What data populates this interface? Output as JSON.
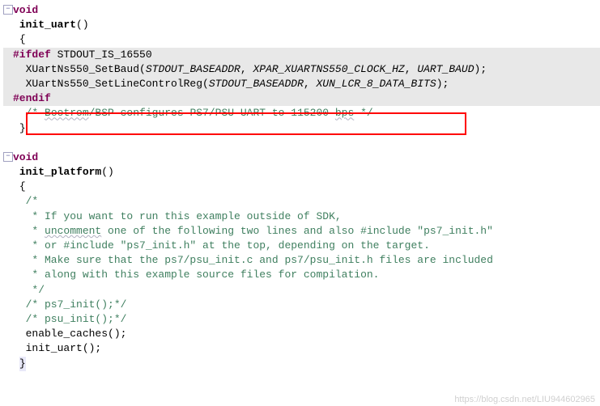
{
  "fn1": {
    "void": "void",
    "name": "init_uart",
    "sig": "()",
    "open": "{",
    "close": "}",
    "ifdef": "#ifdef",
    "ifdef_cond": " STDOUT_IS_16550",
    "l1a": "  XUartNs550_SetBaud",
    "l1b": "(",
    "l1c": "STDOUT_BASEADDR",
    "l1d": ", ",
    "l1e": "XPAR_XUARTNS550_CLOCK_HZ",
    "l1f": ", ",
    "l1g": "UART_BAUD",
    "l1h": ");",
    "l2a": "  XUartNs550_SetLineControlReg",
    "l2b": "(",
    "l2c": "STDOUT_BASEADDR",
    "l2d": ", ",
    "l2e": "XUN_LCR_8_DATA_BITS",
    "l2f": ");",
    "endif": "#endif",
    "comment_pre": "  /* ",
    "comment_w1": "Bootrom",
    "comment_mid1": "/BSP configures PS7/PSU UART to 115200 ",
    "comment_w2": "bps",
    "comment_post": " */"
  },
  "fn2": {
    "void": "void",
    "name": "init_platform",
    "sig": "()",
    "open": "{",
    "close": "}",
    "c_open": "  /*",
    "c1": "   * If you want to run this example outside of SDK,",
    "c2a": "   * ",
    "c2w": "uncomment",
    "c2b": " one of the following two lines and also #include \"ps7_init.h\"",
    "c3": "   * or #include \"ps7_init.h\" at the top, depending on the target.",
    "c4": "   * Make sure that the ps7/psu_init.c and ps7/psu_init.h files are included",
    "c5": "   * along with this example source files for compilation.",
    "c_close": "   */",
    "c_ps7": "  /* ps7_init();*/",
    "c_psu": "  /* psu_init();*/",
    "call1": "  enable_caches",
    "call1b": "();",
    "call2": "  init_uart",
    "call2b": "();"
  },
  "fold": "−",
  "watermark": "https://blog.csdn.net/LIU944602965"
}
